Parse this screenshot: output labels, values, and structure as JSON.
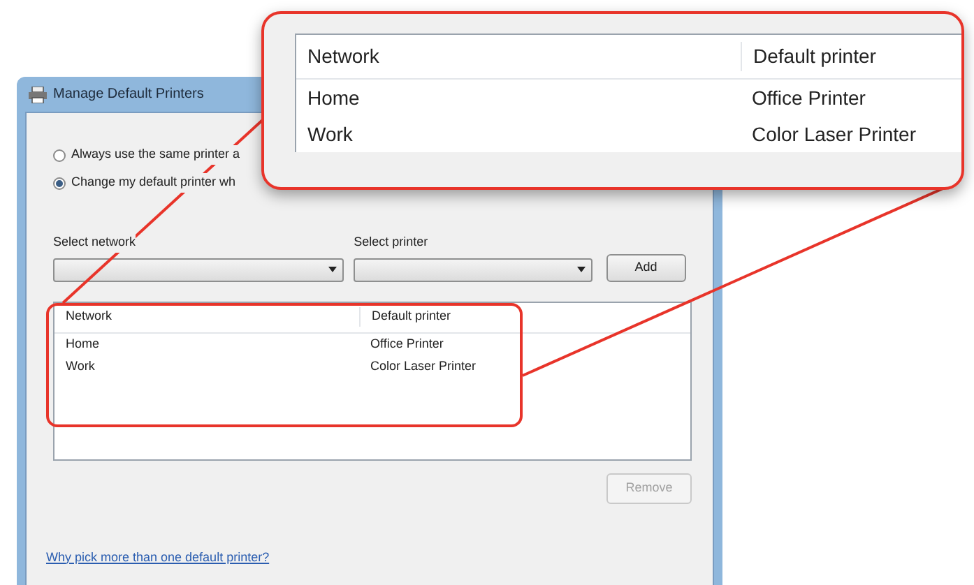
{
  "window": {
    "title": "Manage Default Printers"
  },
  "options": [
    {
      "label": "Always use the same printer a",
      "selected": false
    },
    {
      "label": "Change my default printer wh",
      "selected": true
    }
  ],
  "network_select": {
    "label": "Select network"
  },
  "printer_select": {
    "label": "Select printer"
  },
  "add_button": "Add",
  "table": {
    "columns": [
      "Network",
      "Default printer"
    ],
    "rows": [
      [
        "Home",
        "Office Printer"
      ],
      [
        "Work",
        "Color Laser Printer"
      ]
    ]
  },
  "remove_button": {
    "label": "Remove",
    "disabled": true
  },
  "link": "Why pick more than one default printer?",
  "magnified_table": {
    "columns": [
      "Network",
      "Default printer"
    ],
    "rows": [
      [
        "Home",
        "Office Printer"
      ],
      [
        "Work",
        "Color Laser Printer"
      ]
    ]
  }
}
